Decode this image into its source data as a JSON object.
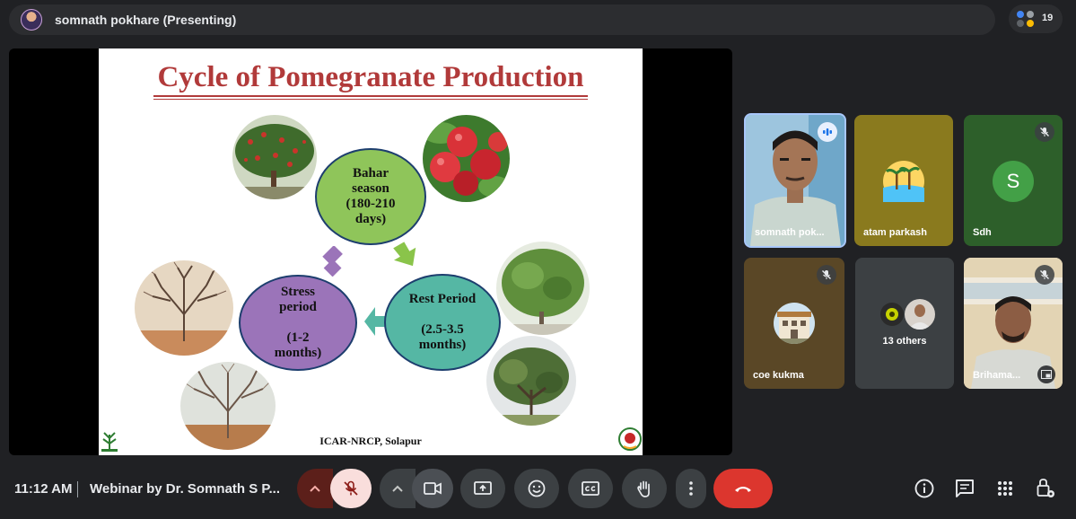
{
  "presenter_bar": {
    "label": "somnath pokhare (Presenting)",
    "participant_count": "19"
  },
  "slide": {
    "title": "Cycle of Pomegranate Production",
    "stages": [
      {
        "text": "Bahar\nseason\n(180-210\ndays)"
      },
      {
        "text": "Rest Period\n\n(2.5-3.5\nmonths)"
      },
      {
        "text": "Stress\nperiod\n\n(1-2\nmonths)"
      }
    ],
    "footer": "ICAR-NRCP, Solapur",
    "colors": {
      "title": "#b13a3a",
      "bahar": "#8fc55a",
      "rest": "#55b7a4",
      "stress": "#9b74b9",
      "arrow_green": "#8ac44a",
      "arrow_purple": "#9b74b9",
      "arrow_teal": "#55b7a4"
    }
  },
  "participants": [
    {
      "name": "somnath pok...",
      "state": "speaking"
    },
    {
      "name": "atam parkash",
      "state": "avatar"
    },
    {
      "name": "Sdh",
      "initial": "S",
      "state": "muted"
    },
    {
      "name": "coe kukma",
      "state": "muted"
    },
    {
      "name": "13 others",
      "state": "group"
    },
    {
      "name": "Brihama...",
      "state": "muted"
    }
  ],
  "bottom_bar": {
    "time": "11:12 AM",
    "meeting_title": "Webinar by Dr. Somnath S P...",
    "buttons": [
      {
        "icon": "chevron-up-icon"
      },
      {
        "icon": "mic-off-icon"
      },
      {
        "icon": "chevron-up-icon"
      },
      {
        "icon": "camera-icon"
      },
      {
        "icon": "present-screen-icon"
      },
      {
        "icon": "emoji-icon"
      },
      {
        "icon": "captions-icon"
      },
      {
        "icon": "raise-hand-icon"
      },
      {
        "icon": "more-options-icon"
      },
      {
        "icon": "end-call-icon"
      }
    ],
    "right_icons": [
      "info-icon",
      "chat-icon",
      "activities-icon",
      "host-controls-icon"
    ]
  }
}
